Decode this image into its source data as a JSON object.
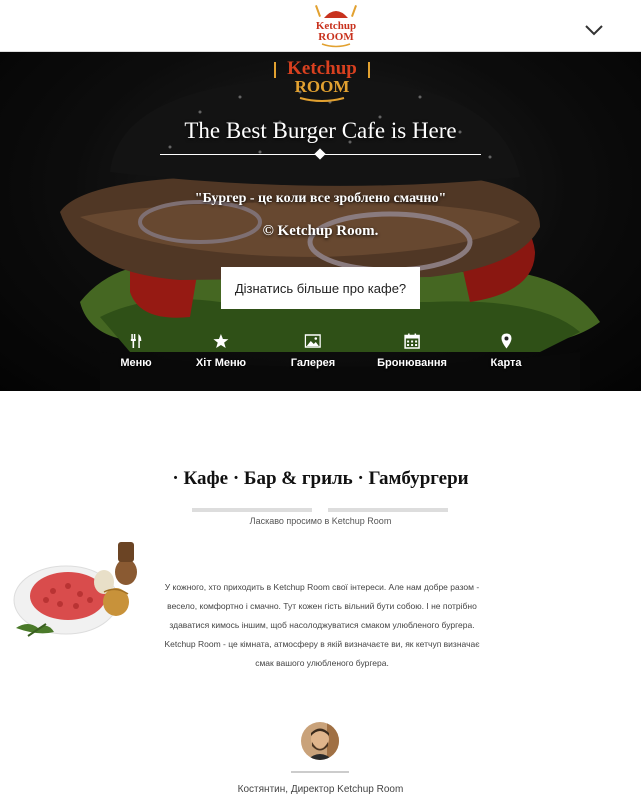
{
  "header": {
    "logo_text": "Ketchup Room",
    "menu_toggle_icon": "chevron-down-icon"
  },
  "hero": {
    "logo_text": "Ketchup Room",
    "title": "The Best Burger Cafe is Here",
    "quote": "\"Бургер - це коли все зроблено смачно\"",
    "copyright": "© Ketchup Room.",
    "cta_label": "Дізнатись більше про кафе?",
    "nav": [
      {
        "label": "Меню",
        "icon": "cutlery-icon"
      },
      {
        "label": "Хіт Меню",
        "icon": "star-icon"
      },
      {
        "label": "Галерея",
        "icon": "image-icon"
      },
      {
        "label": "Бронювання",
        "icon": "calendar-icon"
      },
      {
        "label": "Карта",
        "icon": "map-pin-icon"
      }
    ]
  },
  "about": {
    "title": "· Кафе · Бар & гриль · Гамбургери",
    "subtitle": "Ласкаво просимо в Ketchup Room",
    "description": "У кожного, хто приходить в Ketchup Room свої інтереси. Але нам добре разом - весело, комфортно і смачно. Тут кожен гість вільний бути собою. І не потрібно здаватися кимось іншим, щоб насолоджуватися смаком улюбленого бургера. Ketchup Room - це кімната, атмосферу в якій визначаєте ви, як кетчуп визначає смак вашого улюбленого бургера.",
    "signature": "Костянтин, Директор Ketchup Room"
  },
  "colors": {
    "logo_red": "#c8321e",
    "logo_gold": "#e2a130",
    "hero_bg": "#111111"
  }
}
